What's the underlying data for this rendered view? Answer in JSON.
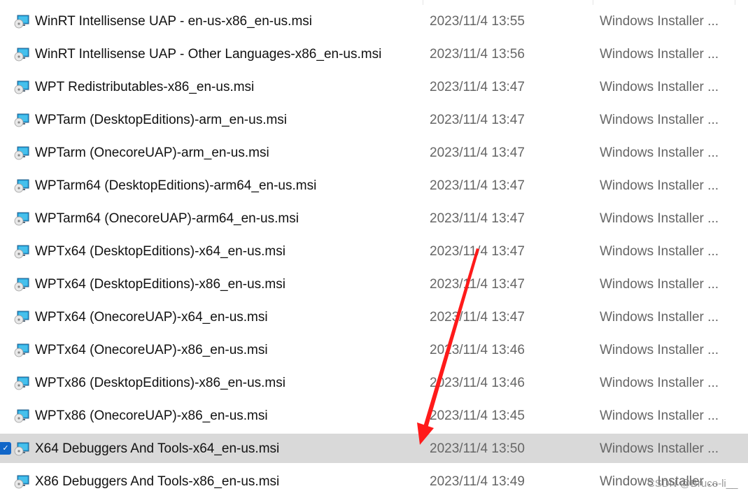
{
  "files": [
    {
      "name": "WinRT Intellisense UAP - en-us-x86_en-us.msi",
      "date": "2023/11/4 13:55",
      "type": "Windows Installer ...",
      "selected": false
    },
    {
      "name": "WinRT Intellisense UAP - Other Languages-x86_en-us.msi",
      "date": "2023/11/4 13:56",
      "type": "Windows Installer ...",
      "selected": false
    },
    {
      "name": "WPT Redistributables-x86_en-us.msi",
      "date": "2023/11/4 13:47",
      "type": "Windows Installer ...",
      "selected": false
    },
    {
      "name": "WPTarm (DesktopEditions)-arm_en-us.msi",
      "date": "2023/11/4 13:47",
      "type": "Windows Installer ...",
      "selected": false
    },
    {
      "name": "WPTarm (OnecoreUAP)-arm_en-us.msi",
      "date": "2023/11/4 13:47",
      "type": "Windows Installer ...",
      "selected": false
    },
    {
      "name": "WPTarm64 (DesktopEditions)-arm64_en-us.msi",
      "date": "2023/11/4 13:47",
      "type": "Windows Installer ...",
      "selected": false
    },
    {
      "name": "WPTarm64 (OnecoreUAP)-arm64_en-us.msi",
      "date": "2023/11/4 13:47",
      "type": "Windows Installer ...",
      "selected": false
    },
    {
      "name": "WPTx64 (DesktopEditions)-x64_en-us.msi",
      "date": "2023/11/4 13:47",
      "type": "Windows Installer ...",
      "selected": false
    },
    {
      "name": "WPTx64 (DesktopEditions)-x86_en-us.msi",
      "date": "2023/11/4 13:47",
      "type": "Windows Installer ...",
      "selected": false
    },
    {
      "name": "WPTx64 (OnecoreUAP)-x64_en-us.msi",
      "date": "2023/11/4 13:47",
      "type": "Windows Installer ...",
      "selected": false
    },
    {
      "name": "WPTx64 (OnecoreUAP)-x86_en-us.msi",
      "date": "2023/11/4 13:46",
      "type": "Windows Installer ...",
      "selected": false
    },
    {
      "name": "WPTx86 (DesktopEditions)-x86_en-us.msi",
      "date": "2023/11/4 13:46",
      "type": "Windows Installer ...",
      "selected": false
    },
    {
      "name": "WPTx86 (OnecoreUAP)-x86_en-us.msi",
      "date": "2023/11/4 13:45",
      "type": "Windows Installer ...",
      "selected": false
    },
    {
      "name": "X64 Debuggers And Tools-x64_en-us.msi",
      "date": "2023/11/4 13:50",
      "type": "Windows Installer ...",
      "selected": true
    },
    {
      "name": "X86 Debuggers And Tools-x86_en-us.msi",
      "date": "2023/11/4 13:49",
      "type": "Windows Installer ...",
      "selected": false
    }
  ],
  "icon": "msi-installer-icon",
  "annotation_color": "#ff1a1a",
  "selection_color": "#d9d9d9",
  "watermark": "CSDN @Bruce-li__"
}
